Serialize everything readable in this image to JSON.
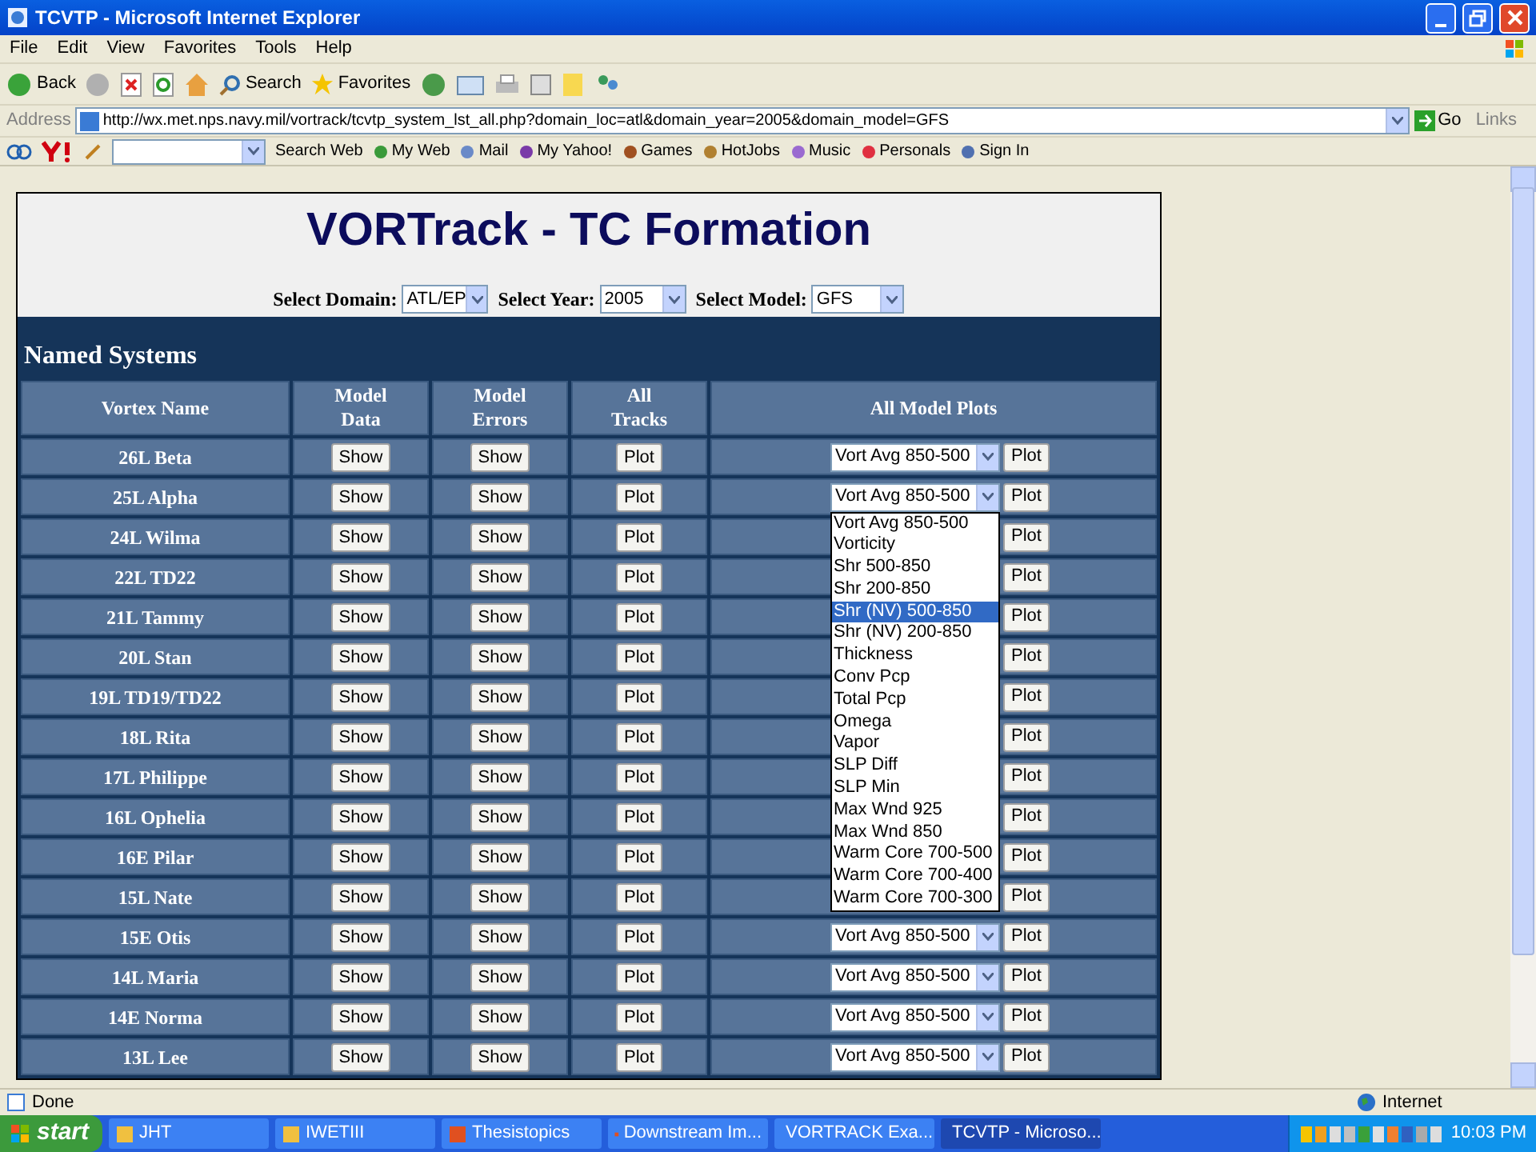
{
  "window": {
    "title": "TCVTP - Microsoft Internet Explorer"
  },
  "menu": [
    "File",
    "Edit",
    "View",
    "Favorites",
    "Tools",
    "Help"
  ],
  "toolbar": {
    "back": "Back",
    "search": "Search",
    "favorites": "Favorites"
  },
  "address": {
    "label": "Address",
    "url": "http://wx.met.nps.navy.mil/vortrack/tcvtp_system_lst_all.php?domain_loc=atl&domain_year=2005&domain_model=GFS",
    "go": "Go",
    "links": "Links"
  },
  "yahoo_toolbar": {
    "search_button": "Search Web",
    "items": [
      "My Web",
      "Mail",
      "My Yahoo!",
      "Games",
      "HotJobs",
      "Music",
      "Personals",
      "Sign In"
    ]
  },
  "page": {
    "title": "VORTrack - TC Formation",
    "filters": [
      {
        "label": "Select Domain:",
        "value": "ATL/EP"
      },
      {
        "label": "Select Year:",
        "value": "2005"
      },
      {
        "label": "Select Model:",
        "value": "GFS"
      }
    ],
    "section": "Named Systems",
    "columns": [
      "Vortex Name",
      "Model Data",
      "Model Errors",
      "All Tracks",
      "All Model Plots"
    ],
    "rows": [
      {
        "name": "26L Beta",
        "data": "Show",
        "errors": "Show",
        "tracks": "Plot",
        "plot_select": "Vort Avg 850-500",
        "plot": "Plot"
      },
      {
        "name": "25L Alpha",
        "data": "Show",
        "errors": "Show",
        "tracks": "Plot",
        "plot_select": "Vort Avg 850-500",
        "plot": "Plot",
        "expanded": true,
        "options": [
          {
            "label": "Vort Avg 850-500",
            "selected": false
          },
          {
            "label": "Vorticity",
            "selected": false
          },
          {
            "label": "Shr 500-850",
            "selected": false
          },
          {
            "label": "Shr 200-850",
            "selected": false
          },
          {
            "label": "Shr (NV) 500-850",
            "selected": true
          },
          {
            "label": "Shr (NV) 200-850",
            "selected": false
          },
          {
            "label": "Thickness",
            "selected": false
          },
          {
            "label": "Conv Pcp",
            "selected": false
          },
          {
            "label": "Total Pcp",
            "selected": false
          },
          {
            "label": "Omega",
            "selected": false
          },
          {
            "label": "Vapor",
            "selected": false
          },
          {
            "label": "SLP Diff",
            "selected": false
          },
          {
            "label": "SLP Min",
            "selected": false
          },
          {
            "label": "Max Wnd 925",
            "selected": false
          },
          {
            "label": "Max Wnd 850",
            "selected": false
          },
          {
            "label": "Warm Core 700-500",
            "selected": false
          },
          {
            "label": "Warm Core 700-400",
            "selected": false
          },
          {
            "label": "Warm Core 700-300",
            "selected": false
          }
        ]
      },
      {
        "name": "24L Wilma",
        "data": "Show",
        "errors": "Show",
        "tracks": "Plot",
        "plot": "Plot"
      },
      {
        "name": "22L TD22",
        "data": "Show",
        "errors": "Show",
        "tracks": "Plot",
        "plot": "Plot"
      },
      {
        "name": "21L Tammy",
        "data": "Show",
        "errors": "Show",
        "tracks": "Plot",
        "plot": "Plot"
      },
      {
        "name": "20L Stan",
        "data": "Show",
        "errors": "Show",
        "tracks": "Plot",
        "plot": "Plot"
      },
      {
        "name": "19L TD19/TD22",
        "data": "Show",
        "errors": "Show",
        "tracks": "Plot",
        "plot": "Plot"
      },
      {
        "name": "18L Rita",
        "data": "Show",
        "errors": "Show",
        "tracks": "Plot",
        "plot": "Plot"
      },
      {
        "name": "17L Philippe",
        "data": "Show",
        "errors": "Show",
        "tracks": "Plot",
        "plot": "Plot"
      },
      {
        "name": "16L Ophelia",
        "data": "Show",
        "errors": "Show",
        "tracks": "Plot",
        "plot": "Plot"
      },
      {
        "name": "16E Pilar",
        "data": "Show",
        "errors": "Show",
        "tracks": "Plot",
        "plot": "Plot"
      },
      {
        "name": "15L Nate",
        "data": "Show",
        "errors": "Show",
        "tracks": "Plot",
        "plot": "Plot"
      },
      {
        "name": "15E Otis",
        "data": "Show",
        "errors": "Show",
        "tracks": "Plot",
        "plot_select": "Vort Avg 850-500",
        "plot": "Plot"
      },
      {
        "name": "14L Maria",
        "data": "Show",
        "errors": "Show",
        "tracks": "Plot",
        "plot_select": "Vort Avg 850-500",
        "plot": "Plot"
      },
      {
        "name": "14E Norma",
        "data": "Show",
        "errors": "Show",
        "tracks": "Plot",
        "plot_select": "Vort Avg 850-500",
        "plot": "Plot"
      },
      {
        "name": "13L Lee",
        "data": "Show",
        "errors": "Show",
        "tracks": "Plot",
        "plot_select": "Vort Avg 850-500",
        "plot": "Plot"
      }
    ]
  },
  "status_bar": {
    "text": "Done",
    "zone": "Internet"
  },
  "taskbar": {
    "start": "start",
    "items": [
      {
        "label": "JHT",
        "active": false
      },
      {
        "label": "IWETIII",
        "active": false
      },
      {
        "label": "Thesistopics",
        "active": false
      },
      {
        "label": "Downstream Im...",
        "active": false
      },
      {
        "label": "VORTRACK Exa...",
        "active": false
      },
      {
        "label": "TCVTP - Microso...",
        "active": true
      }
    ],
    "clock": "10:03 PM"
  }
}
